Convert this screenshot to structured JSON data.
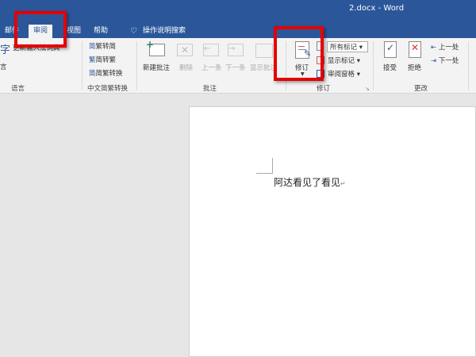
{
  "window": {
    "title": "2.docx  -  Word"
  },
  "tabs": [
    {
      "label": "邮件"
    },
    {
      "label": "审阅"
    },
    {
      "label": "视图"
    },
    {
      "label": "帮助"
    },
    {
      "label": "操作说明搜索"
    }
  ],
  "ribbon": {
    "language": {
      "label": "语言",
      "items": [
        "字",
        "言",
        "更新输入法词典"
      ]
    },
    "chinese_conversion": {
      "label": "中文简繁转换",
      "items": [
        "繁转简",
        "简转繁",
        "简繁转换"
      ]
    },
    "comments": {
      "label": "批注",
      "items": [
        "新建批注",
        "删除",
        "上一条",
        "下一条",
        "显示批注"
      ]
    },
    "tracking": {
      "label": "修订",
      "track_changes": "修订",
      "markup_select": "所有标记",
      "show_markup": "显示标记",
      "review_pane": "审阅窗格"
    },
    "changes": {
      "label": "更改",
      "accept": "接受",
      "reject": "拒绝",
      "previous": "上一处",
      "next": "下一处"
    }
  },
  "document": {
    "text": "阿达看见了看见",
    "para_mark": "↵"
  },
  "colors": {
    "brand": "#2b579a",
    "highlight": "#e50000"
  }
}
